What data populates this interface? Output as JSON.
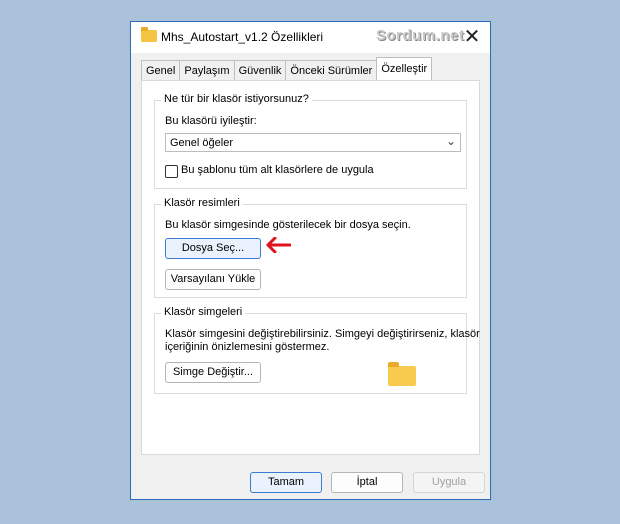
{
  "window": {
    "title": "Mhs_Autostart_v1.2 Özellikleri",
    "watermark": "Sordum.net",
    "close_glyph": "✕"
  },
  "tabs": [
    {
      "label": "Genel"
    },
    {
      "label": "Paylaşım"
    },
    {
      "label": "Güvenlik"
    },
    {
      "label": "Önceki Sürümler"
    },
    {
      "label": "Özelleştir"
    }
  ],
  "folder_type": {
    "group_title": "Ne tür bir klasör istiyorsunuz?",
    "optimize_label": "Bu klasörü iyileştir:",
    "selected_option": "Genel öğeler",
    "apply_subfolders_label": "Bu şablonu tüm alt klasörlere de uygula",
    "apply_subfolders_checked": false
  },
  "folder_pictures": {
    "group_title": "Klasör resimleri",
    "description": "Bu klasör simgesinde gösterilecek bir dosya seçin.",
    "choose_file_button": "Dosya Seç...",
    "restore_default_button": "Varsayılanı Yükle"
  },
  "folder_icons": {
    "group_title": "Klasör simgeleri",
    "description_line1": "Klasör simgesini değiştirebilirsiniz. Simgeyi değiştirirseniz, klasör",
    "description_line2": "içeriğinin önizlemesini göstermez.",
    "change_icon_button": "Simge Değiştir..."
  },
  "footer": {
    "ok_button": "Tamam",
    "cancel_button": "İptal",
    "apply_button": "Uygula"
  },
  "colors": {
    "accent": "#3d7bd1",
    "arrow": "#e0141e"
  }
}
